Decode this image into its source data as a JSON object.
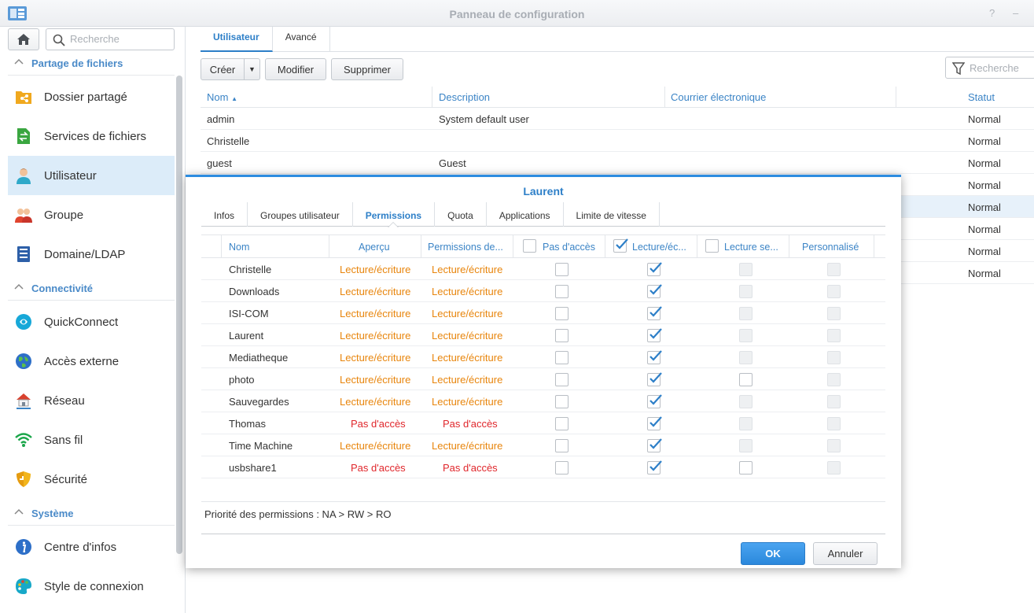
{
  "window": {
    "title": "Panneau de configuration",
    "help": "?",
    "minimize": "–"
  },
  "sidebar": {
    "search_placeholder": "Recherche",
    "sections": [
      {
        "label": "Partage de fichiers",
        "items": [
          {
            "label": "Dossier partagé",
            "icon": "shared-folder-icon"
          },
          {
            "label": "Services de fichiers",
            "icon": "file-services-icon"
          },
          {
            "label": "Utilisateur",
            "icon": "user-icon",
            "active": true
          },
          {
            "label": "Groupe",
            "icon": "group-icon"
          },
          {
            "label": "Domaine/LDAP",
            "icon": "domain-icon"
          }
        ]
      },
      {
        "label": "Connectivité",
        "items": [
          {
            "label": "QuickConnect",
            "icon": "quickconnect-icon"
          },
          {
            "label": "Accès externe",
            "icon": "globe-icon"
          },
          {
            "label": "Réseau",
            "icon": "network-icon"
          },
          {
            "label": "Sans fil",
            "icon": "wifi-icon"
          },
          {
            "label": "Sécurité",
            "icon": "shield-icon"
          }
        ]
      },
      {
        "label": "Système",
        "items": [
          {
            "label": "Centre d'infos",
            "icon": "info-icon"
          },
          {
            "label": "Style de connexion",
            "icon": "palette-icon"
          }
        ]
      }
    ]
  },
  "main": {
    "tabs": [
      "Utilisateur",
      "Avancé"
    ],
    "toolbar": {
      "create": "Créer",
      "modify": "Modifier",
      "delete": "Supprimer"
    },
    "filter_placeholder": "Recherche",
    "columns": [
      "Nom",
      "Description",
      "Courrier électronique",
      "Statut"
    ],
    "rows": [
      {
        "name": "admin",
        "description": "System default user",
        "email": "",
        "status": "Normal"
      },
      {
        "name": "Christelle",
        "description": "",
        "email": "",
        "status": "Normal"
      },
      {
        "name": "guest",
        "description": "Guest",
        "email": "",
        "status": "Normal"
      },
      {
        "name": "",
        "description": "",
        "email": "",
        "status": "Normal"
      },
      {
        "name": "",
        "description": "",
        "email": "",
        "status": "Normal"
      },
      {
        "name": "",
        "description": "",
        "email": "",
        "status": "Normal"
      },
      {
        "name": "",
        "description": "",
        "email": "",
        "status": "Normal"
      },
      {
        "name": "",
        "description": "",
        "email": "",
        "status": "Normal"
      }
    ]
  },
  "dialog": {
    "title": "Laurent",
    "tabs": [
      "Infos",
      "Groupes utilisateur",
      "Permissions",
      "Quota",
      "Applications",
      "Limite de vitesse"
    ],
    "active_tab": "Permissions",
    "columns": [
      "Nom",
      "Aperçu",
      "Permissions de...",
      "Pas d'accès",
      "Lecture/éc...",
      "Lecture se...",
      "Personnalisé"
    ],
    "rows": [
      {
        "name": "Christelle",
        "preview": "Lecture/écriture",
        "perm": "Lecture/écriture",
        "ro_enabled": false
      },
      {
        "name": "Downloads",
        "preview": "Lecture/écriture",
        "perm": "Lecture/écriture",
        "ro_enabled": false
      },
      {
        "name": "ISI-COM",
        "preview": "Lecture/écriture",
        "perm": "Lecture/écriture",
        "ro_enabled": false
      },
      {
        "name": "Laurent",
        "preview": "Lecture/écriture",
        "perm": "Lecture/écriture",
        "ro_enabled": false
      },
      {
        "name": "Mediatheque",
        "preview": "Lecture/écriture",
        "perm": "Lecture/écriture",
        "ro_enabled": false
      },
      {
        "name": "photo",
        "preview": "Lecture/écriture",
        "perm": "Lecture/écriture",
        "ro_enabled": true
      },
      {
        "name": "Sauvegardes",
        "preview": "Lecture/écriture",
        "perm": "Lecture/écriture",
        "ro_enabled": false
      },
      {
        "name": "Thomas",
        "preview": "Pas d'accès",
        "perm": "Pas d'accès",
        "ro_enabled": false
      },
      {
        "name": "Time Machine",
        "preview": "Lecture/écriture",
        "perm": "Lecture/écriture",
        "ro_enabled": false
      },
      {
        "name": "usbshare1",
        "preview": "Pas d'accès",
        "perm": "Pas d'accès",
        "ro_enabled": true
      }
    ],
    "priority": "Priorité des permissions : NA > RW > RO",
    "ok": "OK",
    "cancel": "Annuler"
  },
  "colors": {
    "accent": "#2d7fc8",
    "rw": "#e8850c",
    "na": "#e0262b",
    "selected": "#dcecf9"
  }
}
